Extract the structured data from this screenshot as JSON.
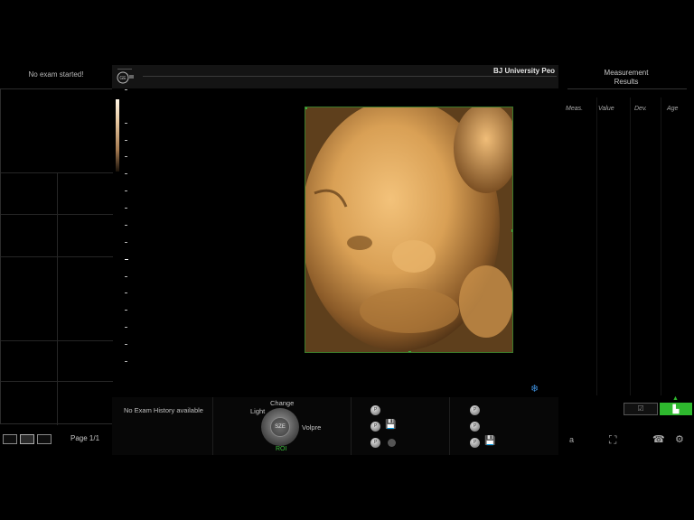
{
  "left_panel": {
    "title": "No exam started!"
  },
  "header": {
    "facility": "BJ  University  Peo"
  },
  "measurement": {
    "title_line1": "Measurement",
    "title_line2": "Results",
    "columns": [
      "Meas.",
      "Value",
      "Dev.",
      "Age"
    ]
  },
  "bottom": {
    "history": "No Exam History available",
    "rotation": {
      "change": "Change",
      "light": "Light",
      "volume": "Volpre",
      "center": "SZE",
      "roi": "ROI"
    },
    "page_label": "Page 1/1"
  },
  "icons": {
    "logo": "ge-logo-icon",
    "freeze": "snowflake-icon",
    "network": "network-icon",
    "phone": "phone-icon",
    "settings": "gear-icon"
  },
  "system": {
    "a_label": "a"
  },
  "colors": {
    "roi_border": "#3a7a2a",
    "accent_green": "#2eb82e",
    "freeze_blue": "#3c8bd6"
  }
}
